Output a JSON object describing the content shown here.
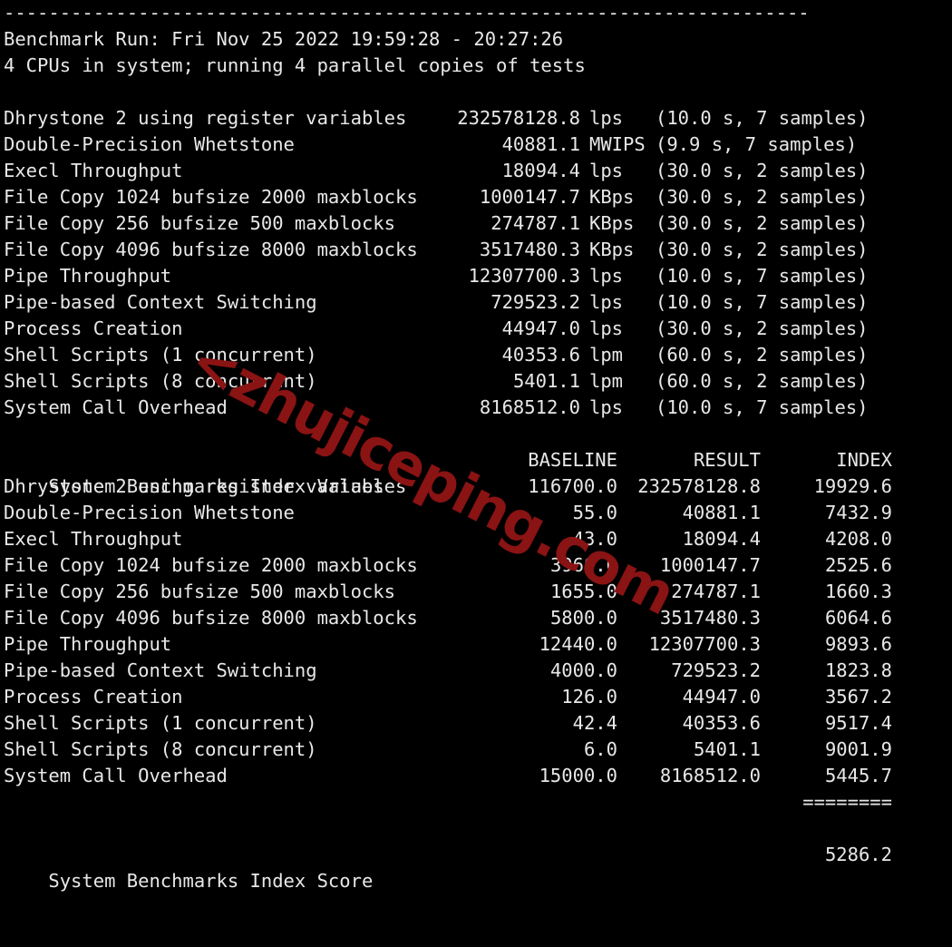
{
  "terminal": {
    "background_color": "#000000",
    "text_color": "#e8e8e8",
    "separator_top": "------------------------------------------------------------------------",
    "benchmark_run": "Benchmark Run: Fri Nov 25 2022 19:59:28 - 20:27:26",
    "cpu_info": "4 CPUs in system; running 4 parallel copies of tests",
    "index_separator": "========",
    "blank": ""
  },
  "watermark": {
    "text": "<zhujiceping.com",
    "color": "#8a1313"
  },
  "results_header": {
    "name": "",
    "value": "",
    "unit": "",
    "timing": ""
  },
  "results": [
    {
      "name": "Dhrystone 2 using register variables",
      "value": "232578128.8",
      "unit": "lps",
      "timing": "(10.0 s, 7 samples)"
    },
    {
      "name": "Double-Precision Whetstone",
      "value": "40881.1",
      "unit": "MWIPS",
      "timing": "(9.9 s, 7 samples)"
    },
    {
      "name": "Execl Throughput",
      "value": "18094.4",
      "unit": "lps",
      "timing": "(30.0 s, 2 samples)"
    },
    {
      "name": "File Copy 1024 bufsize 2000 maxblocks",
      "value": "1000147.7",
      "unit": "KBps",
      "timing": "(30.0 s, 2 samples)"
    },
    {
      "name": "File Copy 256 bufsize 500 maxblocks",
      "value": "274787.1",
      "unit": "KBps",
      "timing": "(30.0 s, 2 samples)"
    },
    {
      "name": "File Copy 4096 bufsize 8000 maxblocks",
      "value": "3517480.3",
      "unit": "KBps",
      "timing": "(30.0 s, 2 samples)"
    },
    {
      "name": "Pipe Throughput",
      "value": "12307700.3",
      "unit": "lps",
      "timing": "(10.0 s, 7 samples)"
    },
    {
      "name": "Pipe-based Context Switching",
      "value": "729523.2",
      "unit": "lps",
      "timing": "(10.0 s, 7 samples)"
    },
    {
      "name": "Process Creation",
      "value": "44947.0",
      "unit": "lps",
      "timing": "(30.0 s, 2 samples)"
    },
    {
      "name": "Shell Scripts (1 concurrent)",
      "value": "40353.6",
      "unit": "lpm",
      "timing": "(60.0 s, 2 samples)"
    },
    {
      "name": "Shell Scripts (8 concurrent)",
      "value": "5401.1",
      "unit": "lpm",
      "timing": "(60.0 s, 2 samples)"
    },
    {
      "name": "System Call Overhead",
      "value": "8168512.0",
      "unit": "lps",
      "timing": "(10.0 s, 7 samples)"
    }
  ],
  "index_table": {
    "title": "System Benchmarks Index Values",
    "columns": {
      "baseline": "BASELINE",
      "result": "RESULT",
      "index": "INDEX"
    },
    "rows": [
      {
        "name": "Dhrystone 2 using register variables",
        "baseline": "116700.0",
        "result": "232578128.8",
        "index": "19929.6"
      },
      {
        "name": "Double-Precision Whetstone",
        "baseline": "55.0",
        "result": "40881.1",
        "index": "7432.9"
      },
      {
        "name": "Execl Throughput",
        "baseline": "43.0",
        "result": "18094.4",
        "index": "4208.0"
      },
      {
        "name": "File Copy 1024 bufsize 2000 maxblocks",
        "baseline": "3960.0",
        "result": "1000147.7",
        "index": "2525.6"
      },
      {
        "name": "File Copy 256 bufsize 500 maxblocks",
        "baseline": "1655.0",
        "result": "274787.1",
        "index": "1660.3"
      },
      {
        "name": "File Copy 4096 bufsize 8000 maxblocks",
        "baseline": "5800.0",
        "result": "3517480.3",
        "index": "6064.6"
      },
      {
        "name": "Pipe Throughput",
        "baseline": "12440.0",
        "result": "12307700.3",
        "index": "9893.6"
      },
      {
        "name": "Pipe-based Context Switching",
        "baseline": "4000.0",
        "result": "729523.2",
        "index": "1823.8"
      },
      {
        "name": "Process Creation",
        "baseline": "126.0",
        "result": "44947.0",
        "index": "3567.2"
      },
      {
        "name": "Shell Scripts (1 concurrent)",
        "baseline": "42.4",
        "result": "40353.6",
        "index": "9517.4"
      },
      {
        "name": "Shell Scripts (8 concurrent)",
        "baseline": "6.0",
        "result": "5401.1",
        "index": "9001.9"
      },
      {
        "name": "System Call Overhead",
        "baseline": "15000.0",
        "result": "8168512.0",
        "index": "5445.7"
      }
    ],
    "total": {
      "label": "System Benchmarks Index Score",
      "value": "5286.2"
    }
  }
}
